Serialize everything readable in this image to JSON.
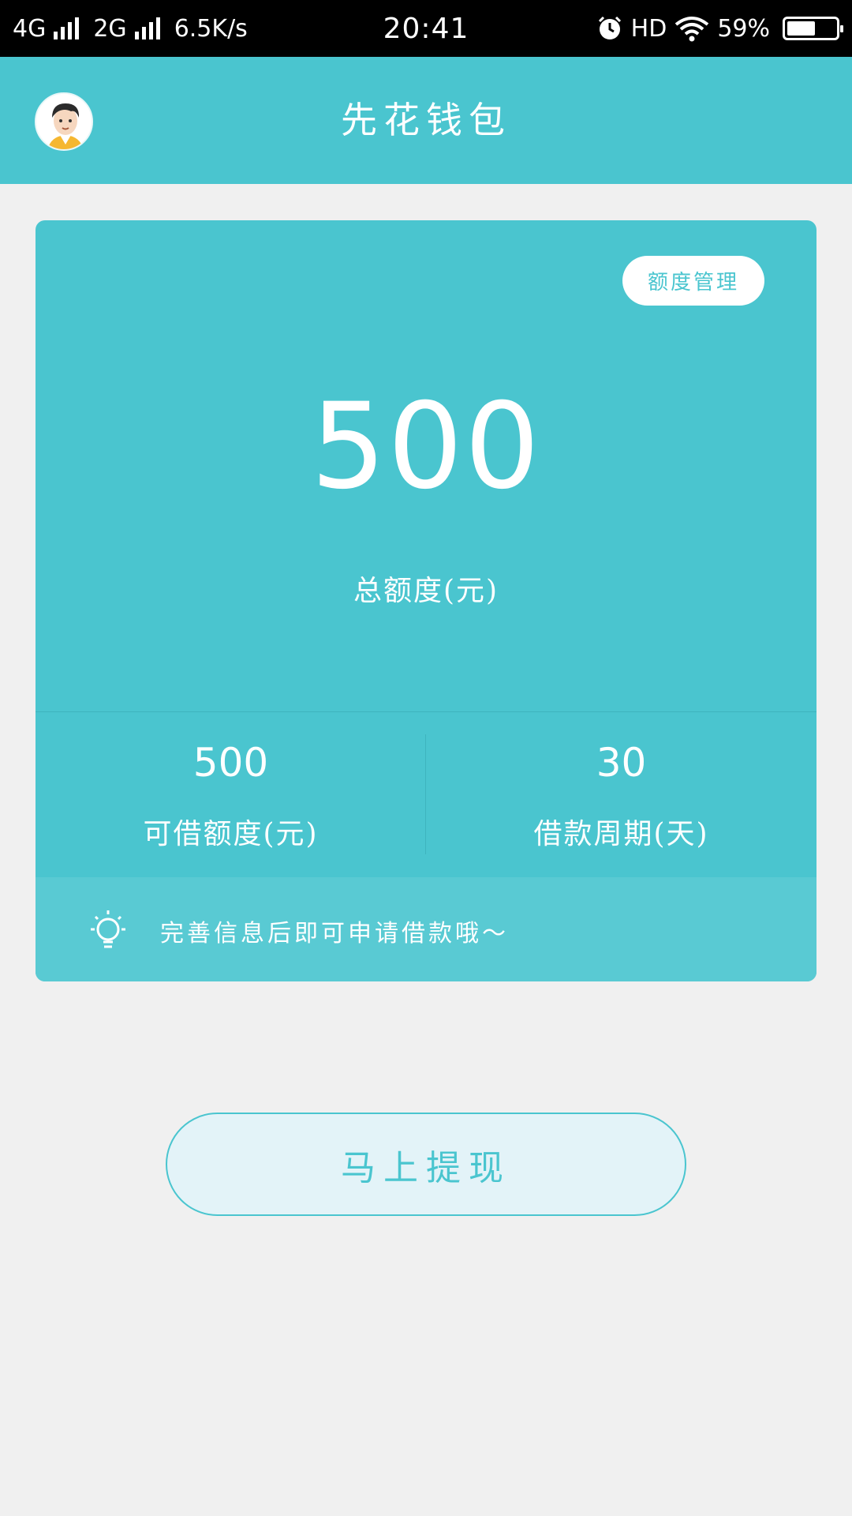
{
  "status_bar": {
    "network1": "4G",
    "network2": "2G",
    "speed": "6.5K/s",
    "time": "20:41",
    "hd": "HD",
    "battery_text": "59%",
    "battery_level": 0.59
  },
  "header": {
    "title": "先花钱包",
    "avatar_icon": "avatar-icon"
  },
  "card": {
    "quota_button": "额度管理",
    "total_amount": "500",
    "total_label": "总额度(元)",
    "available_value": "500",
    "available_label": "可借额度(元)",
    "period_value": "30",
    "period_label": "借款周期(天)",
    "tip_icon": "lightbulb-icon",
    "tip_text": "完善信息后即可申请借款哦～"
  },
  "withdraw_button": "马上提现",
  "colors": {
    "primary": "#4ac5cf",
    "tip_bar": "#59cad3",
    "background": "#f0f0f0",
    "button_bg": "#e3f3f8"
  }
}
